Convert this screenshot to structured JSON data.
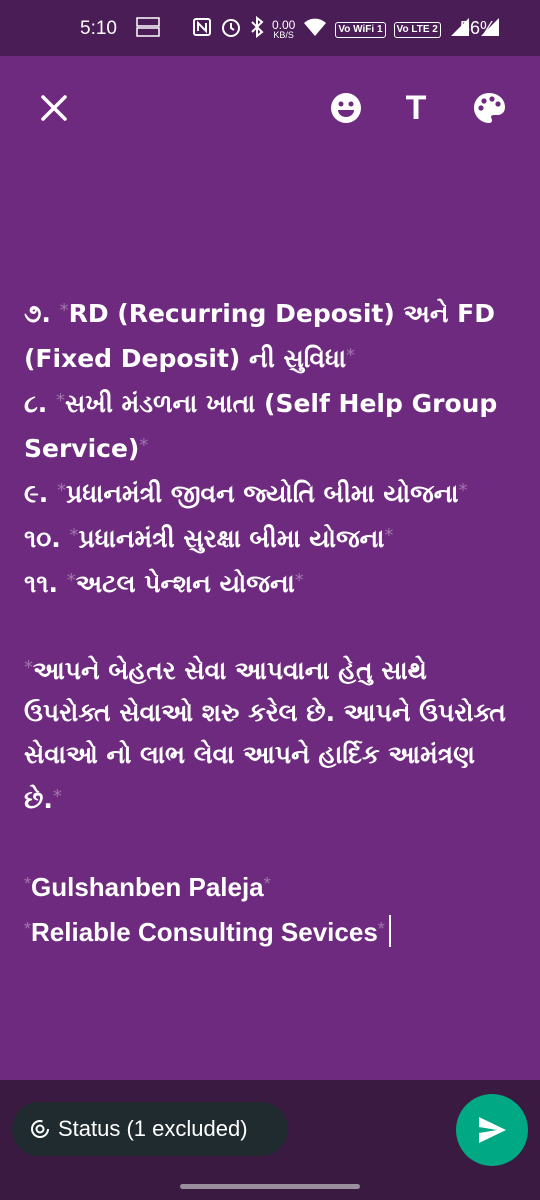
{
  "status_bar": {
    "time": "5:10",
    "speed_value": "0.00",
    "speed_unit": "KB/S",
    "volte_wifi": "Vo WiFi 1",
    "volte_lte": "Vo LTE 2",
    "battery": "56%"
  },
  "toolbar": {
    "close_icon": "close-icon",
    "emoji_icon": "emoji-icon",
    "text_label": "T",
    "palette_icon": "palette-icon"
  },
  "message": {
    "l1": "૭. ",
    "l1b": "RD (Recurring Deposit) અને FD",
    "l2": "(Fixed Deposit) ની સુવિધા",
    "l3": "૮. ",
    "l3b": "સખી મંડળના ખાતા (Self Help Group",
    "l4": "Service)",
    "l5": "૯. ",
    "l5b": "પ્રધાનમંત્રી જીવન જ્યોતિ બીમા યોજના",
    "l6": "૧૦. ",
    "l6b": "પ્રધાનમંત્રી સુરક્ષા બીમા યોજના",
    "l7": "૧૧. ",
    "l7b": "અટલ પેન્શન યોજના",
    "p1": "આપને બેહતર સેવા આપવાના હેતુ સાથે",
    "p2": "ઉપરોક્ત સેવાઓ શરુ કરેલ છે. આપને ઉપરોક્ત",
    "p3": "સેવાઓ નો લાભ લેવા આપને હાર્દિક આમંત્રણ",
    "p4": "છે.",
    "sig1": "Gulshanben Paleja",
    "sig2": "Reliable Consulting Sevices",
    "ast": "*"
  },
  "bottom": {
    "status_label": "Status (1 excluded)",
    "accent": "#00a884"
  }
}
